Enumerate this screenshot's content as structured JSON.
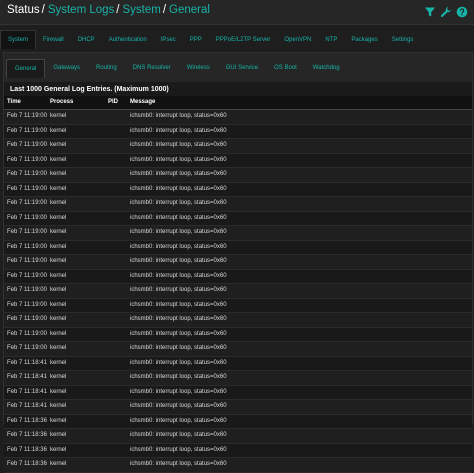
{
  "breadcrumb": {
    "root": "Status",
    "sep": "/",
    "items": [
      "System Logs",
      "System",
      "General"
    ]
  },
  "colors": {
    "accent": "#17b4a8",
    "bg": "#1e1e1e"
  },
  "icons": [
    "filter-icon",
    "wrench-icon",
    "help-icon"
  ],
  "primary_tabs": [
    "System",
    "Firewall",
    "DHCP",
    "Authentication",
    "IPsec",
    "PPP",
    "PPPoE/L2TP Server",
    "OpenVPN",
    "NTP",
    "Packages",
    "Settings"
  ],
  "secondary_tabs": [
    "General",
    "Gateways",
    "Routing",
    "DNS Resolver",
    "Wireless",
    "GUI Service",
    "OS Boot",
    "Watchdog"
  ],
  "panel": {
    "title": "Last 1000 General Log Entries. (Maximum 1000)"
  },
  "table": {
    "headers": {
      "time": "Time",
      "process": "Process",
      "pid": "PID",
      "message": "Message"
    },
    "rows": [
      {
        "time": "Feb 7 11:19:00",
        "process": "kernel",
        "pid": "",
        "message": "ichsmb0: interrupt loop, status=0x60"
      },
      {
        "time": "Feb 7 11:19:00",
        "process": "kernel",
        "pid": "",
        "message": "ichsmb0: interrupt loop, status=0x60"
      },
      {
        "time": "Feb 7 11:19:00",
        "process": "kernel",
        "pid": "",
        "message": "ichsmb0: interrupt loop, status=0x60"
      },
      {
        "time": "Feb 7 11:19:00",
        "process": "kernel",
        "pid": "",
        "message": "ichsmb0: interrupt loop, status=0x60"
      },
      {
        "time": "Feb 7 11:19:00",
        "process": "kernel",
        "pid": "",
        "message": "ichsmb0: interrupt loop, status=0x60"
      },
      {
        "time": "Feb 7 11:19:00",
        "process": "kernel",
        "pid": "",
        "message": "ichsmb0: interrupt loop, status=0x60"
      },
      {
        "time": "Feb 7 11:19:00",
        "process": "kernel",
        "pid": "",
        "message": "ichsmb0: interrupt loop, status=0x60"
      },
      {
        "time": "Feb 7 11:19:00",
        "process": "kernel",
        "pid": "",
        "message": "ichsmb0: interrupt loop, status=0x60"
      },
      {
        "time": "Feb 7 11:19:00",
        "process": "kernel",
        "pid": "",
        "message": "ichsmb0: interrupt loop, status=0x60"
      },
      {
        "time": "Feb 7 11:19:00",
        "process": "kernel",
        "pid": "",
        "message": "ichsmb0: interrupt loop, status=0x60"
      },
      {
        "time": "Feb 7 11:19:00",
        "process": "kernel",
        "pid": "",
        "message": "ichsmb0: interrupt loop, status=0x60"
      },
      {
        "time": "Feb 7 11:19:00",
        "process": "kernel",
        "pid": "",
        "message": "ichsmb0: interrupt loop, status=0x60"
      },
      {
        "time": "Feb 7 11:19:00",
        "process": "kernel",
        "pid": "",
        "message": "ichsmb0: interrupt loop, status=0x60"
      },
      {
        "time": "Feb 7 11:19:00",
        "process": "kernel",
        "pid": "",
        "message": "ichsmb0: interrupt loop, status=0x60"
      },
      {
        "time": "Feb 7 11:19:00",
        "process": "kernel",
        "pid": "",
        "message": "ichsmb0: interrupt loop, status=0x60"
      },
      {
        "time": "Feb 7 11:19:00",
        "process": "kernel",
        "pid": "",
        "message": "ichsmb0: interrupt loop, status=0x60"
      },
      {
        "time": "Feb 7 11:19:00",
        "process": "kernel",
        "pid": "",
        "message": "ichsmb0: interrupt loop, status=0x60"
      },
      {
        "time": "Feb 7 11:18:41",
        "process": "kernel",
        "pid": "",
        "message": "ichsmb0: interrupt loop, status=0x60"
      },
      {
        "time": "Feb 7 11:18:41",
        "process": "kernel",
        "pid": "",
        "message": "ichsmb0: interrupt loop, status=0x60"
      },
      {
        "time": "Feb 7 11:18:41",
        "process": "kernel",
        "pid": "",
        "message": "ichsmb0: interrupt loop, status=0x60"
      },
      {
        "time": "Feb 7 11:18:41",
        "process": "kernel",
        "pid": "",
        "message": "ichsmb0: interrupt loop, status=0x60"
      },
      {
        "time": "Feb 7 11:18:36",
        "process": "kernel",
        "pid": "",
        "message": "ichsmb0: interrupt loop, status=0x60"
      },
      {
        "time": "Feb 7 11:18:36",
        "process": "kernel",
        "pid": "",
        "message": "ichsmb0: interrupt loop, status=0x60"
      },
      {
        "time": "Feb 7 11:18:36",
        "process": "kernel",
        "pid": "",
        "message": "ichsmb0: interrupt loop, status=0x60"
      },
      {
        "time": "Feb 7 11:18:36",
        "process": "kernel",
        "pid": "",
        "message": "ichsmb0: interrupt loop, status=0x60"
      }
    ]
  }
}
